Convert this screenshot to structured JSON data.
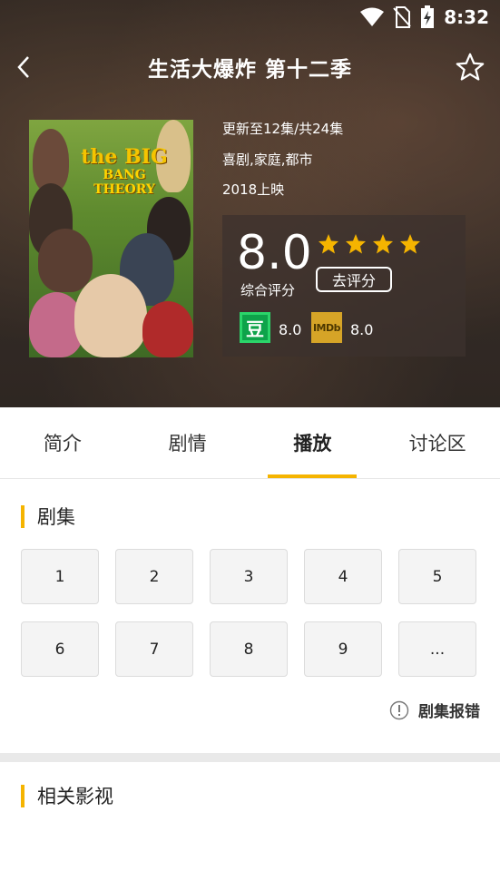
{
  "status_bar": {
    "time": "8:32"
  },
  "header": {
    "title": "生活大爆炸 第十二季",
    "back_icon": "chevron-left-icon",
    "favorite_icon": "star-outline-icon"
  },
  "poster": {
    "title_line1": "the BIG",
    "title_line2": "BANG",
    "title_line3": "THEORY"
  },
  "meta": {
    "update": "更新至12集/共24集",
    "genres": "喜剧,家庭,都市",
    "release": "2018上映"
  },
  "rating": {
    "score": "8.0",
    "score_label": "综合评分",
    "stars": 4,
    "rate_button": "去评分",
    "douban_logo": "豆",
    "douban_score": "8.0",
    "imdb_logo": "IMDb",
    "imdb_score": "8.0"
  },
  "tabs": [
    {
      "label": "简介",
      "active": false
    },
    {
      "label": "剧情",
      "active": false
    },
    {
      "label": "播放",
      "active": true
    },
    {
      "label": "讨论区",
      "active": false
    }
  ],
  "episodes_section": {
    "title": "剧集",
    "episodes": [
      "1",
      "2",
      "3",
      "4",
      "5",
      "6",
      "7",
      "8",
      "9",
      "..."
    ],
    "report_label": "剧集报错",
    "report_icon": "info-circle-icon"
  },
  "related_section": {
    "title": "相关影视"
  },
  "colors": {
    "accent": "#f5b400",
    "star": "#f5b400"
  }
}
